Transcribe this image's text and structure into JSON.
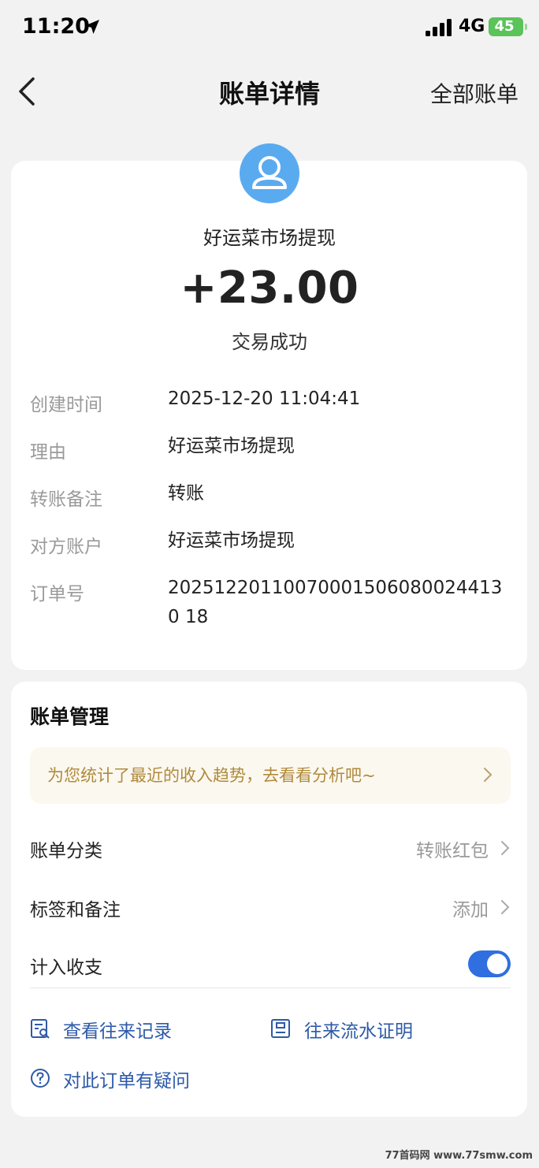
{
  "status_bar": {
    "time": "11:20",
    "network": "4G",
    "battery": "45"
  },
  "nav": {
    "title": "账单详情",
    "right_action": "全部账单"
  },
  "summary": {
    "merchant": "好运菜市场提现",
    "amount": "+23.00",
    "status": "交易成功"
  },
  "details": [
    {
      "label": "创建时间",
      "value": "2025-12-20 11:04:41"
    },
    {
      "label": "理由",
      "value": "好运菜市场提现"
    },
    {
      "label": "转账备注",
      "value": "转账"
    },
    {
      "label": "对方账户",
      "value": "好运菜市场提现"
    },
    {
      "label": "订单号",
      "value": "202512201100700015060800244130 18"
    }
  ],
  "management": {
    "title": "账单管理",
    "tip": "为您统计了最近的收入趋势，去看看分析吧~",
    "category": {
      "label": "账单分类",
      "value": "转账红包"
    },
    "tags": {
      "label": "标签和备注",
      "value": "添加"
    },
    "include": {
      "label": "计入收支",
      "enabled": true
    }
  },
  "links": {
    "records": "查看往来记录",
    "proof": "往来流水证明",
    "question": "对此订单有疑问"
  },
  "watermark": "77首码网 www.77smw.com"
}
